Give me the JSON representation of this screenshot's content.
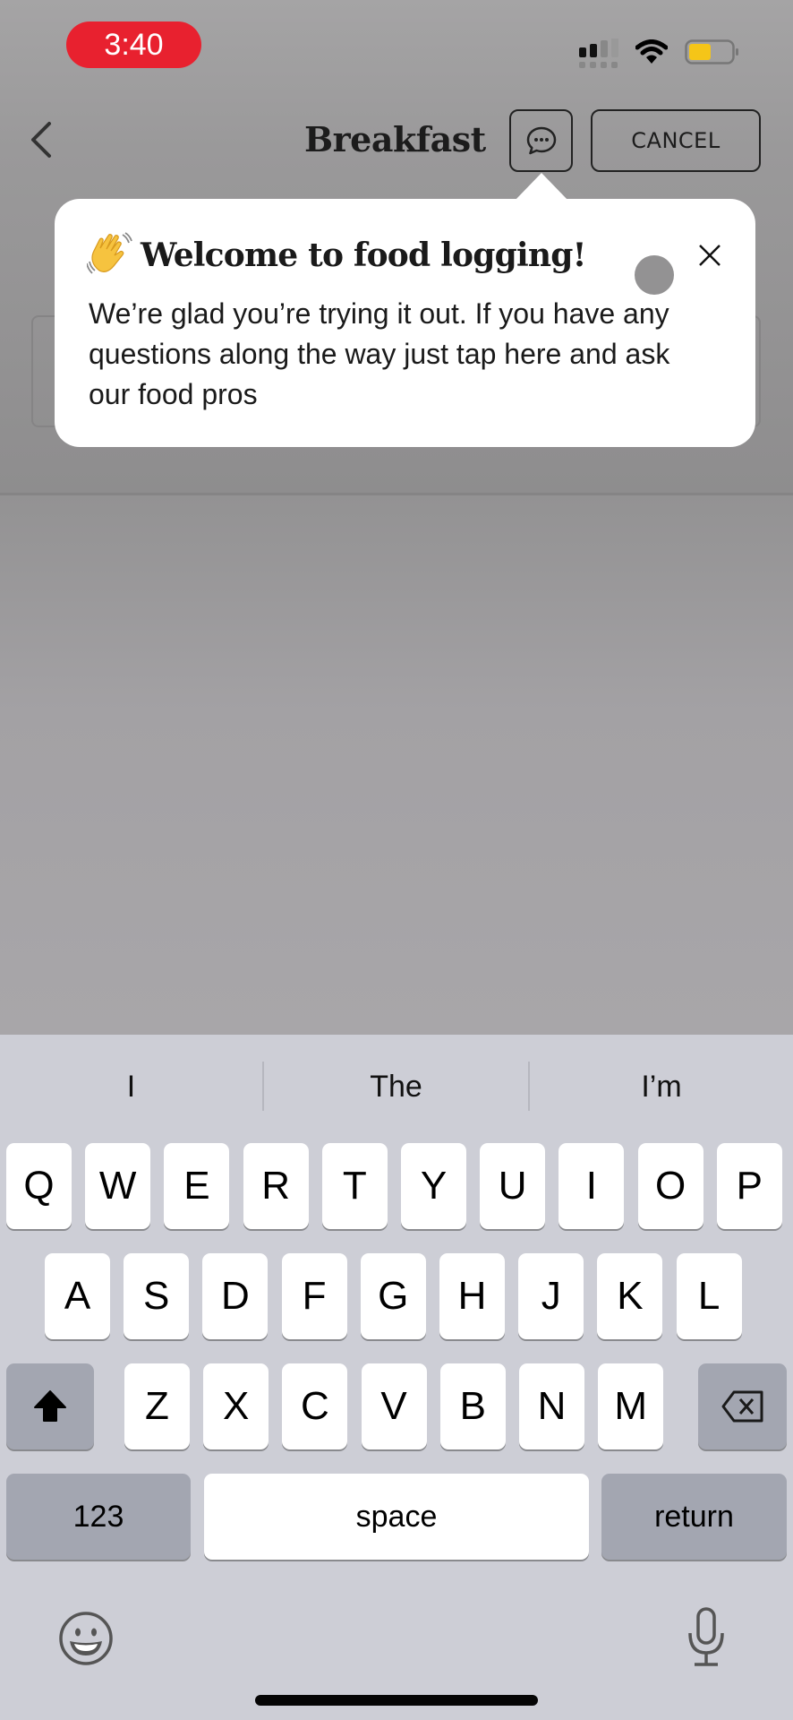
{
  "status_bar": {
    "time": "3:40",
    "signal_bars": 2,
    "signal_bars_total": 4,
    "battery_level": 0.5,
    "battery_color": "#f5c518",
    "time_pill_color": "#e8212f"
  },
  "header": {
    "title": "Breakfast",
    "back_icon": "chevron-left-icon",
    "chat_icon": "chat-bubble-ellipsis-icon",
    "cancel_label": "CANCEL"
  },
  "popover": {
    "emoji": "👋",
    "title": "Welcome to food logging!",
    "body": "We’re glad you’re trying it out. If you have any questions along the way just tap here and ask our food pros",
    "close_icon": "close-icon"
  },
  "keyboard": {
    "suggestions": [
      "I",
      "The",
      "I’m"
    ],
    "rows": [
      [
        "Q",
        "W",
        "E",
        "R",
        "T",
        "Y",
        "U",
        "I",
        "O",
        "P"
      ],
      [
        "A",
        "S",
        "D",
        "F",
        "G",
        "H",
        "J",
        "K",
        "L"
      ],
      [
        "Z",
        "X",
        "C",
        "V",
        "B",
        "N",
        "M"
      ]
    ],
    "shift_icon": "shift-icon",
    "delete_icon": "backspace-icon",
    "numbers_label": "123",
    "space_label": "space",
    "return_label": "return",
    "emoji_icon": "emoji-icon",
    "mic_icon": "microphone-icon"
  }
}
